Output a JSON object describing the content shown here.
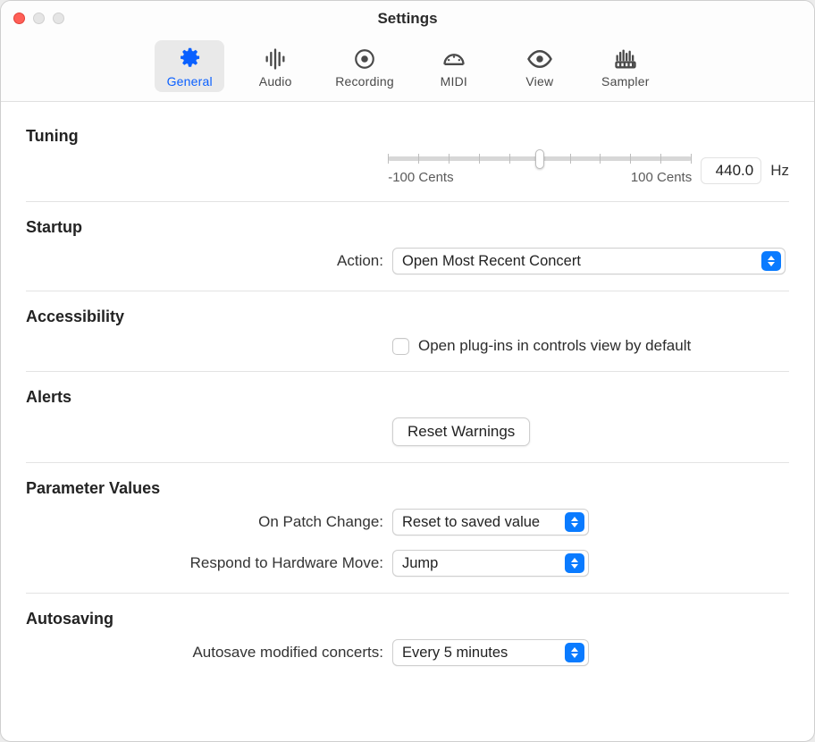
{
  "window": {
    "title": "Settings"
  },
  "tabs": {
    "general": "General",
    "audio": "Audio",
    "recording": "Recording",
    "midi": "MIDI",
    "view": "View",
    "sampler": "Sampler"
  },
  "tuning": {
    "heading": "Tuning",
    "min_label": "-100 Cents",
    "max_label": "100 Cents",
    "value": "440.0",
    "unit": "Hz"
  },
  "startup": {
    "heading": "Startup",
    "action_label": "Action:",
    "action_value": "Open Most Recent Concert"
  },
  "accessibility": {
    "heading": "Accessibility",
    "checkbox_label": "Open plug-ins in controls view by default"
  },
  "alerts": {
    "heading": "Alerts",
    "button": "Reset Warnings"
  },
  "parameter": {
    "heading": "Parameter Values",
    "on_patch_label": "On Patch Change:",
    "on_patch_value": "Reset to saved value",
    "hardware_label": "Respond to Hardware Move:",
    "hardware_value": "Jump"
  },
  "autosaving": {
    "heading": "Autosaving",
    "label": "Autosave modified concerts:",
    "value": "Every 5 minutes"
  }
}
